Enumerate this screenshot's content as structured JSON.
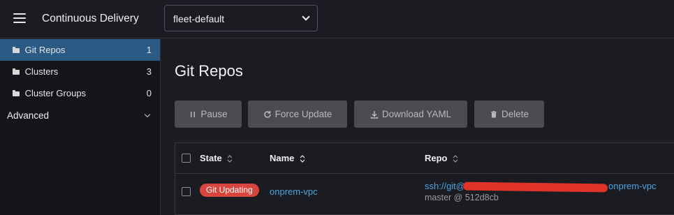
{
  "header": {
    "app_title": "Continuous Delivery",
    "namespace": "fleet-default"
  },
  "sidebar": {
    "items": [
      {
        "label": "Git Repos",
        "count": "1",
        "active": true,
        "icon": "folder-icon"
      },
      {
        "label": "Clusters",
        "count": "3",
        "active": false,
        "icon": "folder-icon"
      },
      {
        "label": "Cluster Groups",
        "count": "0",
        "active": false,
        "icon": "folder-icon"
      }
    ],
    "group_label": "Advanced"
  },
  "main": {
    "title": "Git Repos",
    "buttons": {
      "pause": "Pause",
      "force_update": "Force Update",
      "download_yaml": "Download YAML",
      "delete": "Delete"
    }
  },
  "table": {
    "columns": [
      "State",
      "Name",
      "Repo"
    ],
    "rows": [
      {
        "state": "Git Updating",
        "name": "onprem-vpc",
        "repo_prefix": "ssh://git@",
        "repo_suffix": "onprem-vpc",
        "branch_commit": "master @ 512d8cb"
      }
    ]
  },
  "colors": {
    "accent": "#2b5b85",
    "link": "#4ea3e3",
    "error_badge": "#d9453d",
    "background": "#1b1c21"
  }
}
